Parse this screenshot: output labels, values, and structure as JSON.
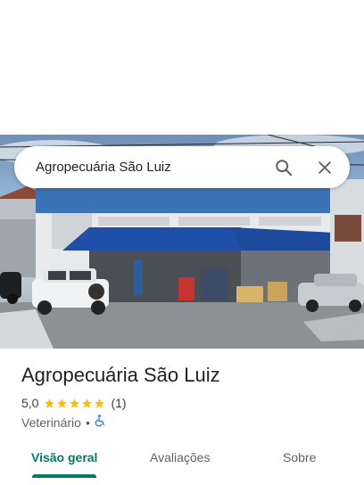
{
  "search": {
    "query": "Agropecuária São Luiz"
  },
  "place": {
    "name": "Agropecuária São Luiz",
    "rating": "5,0",
    "rating_value": 5,
    "reviews_count": "(1)",
    "category": "Veterinário",
    "separator": "•",
    "accessibility_icon": "wheelchair-icon"
  },
  "tabs": [
    {
      "label": "Visão geral",
      "active": true
    },
    {
      "label": "Avaliações",
      "active": false
    },
    {
      "label": "Sobre",
      "active": false
    }
  ],
  "colors": {
    "accent": "#00796b",
    "star": "#fbbc04",
    "accessibility": "#1a73e8"
  }
}
